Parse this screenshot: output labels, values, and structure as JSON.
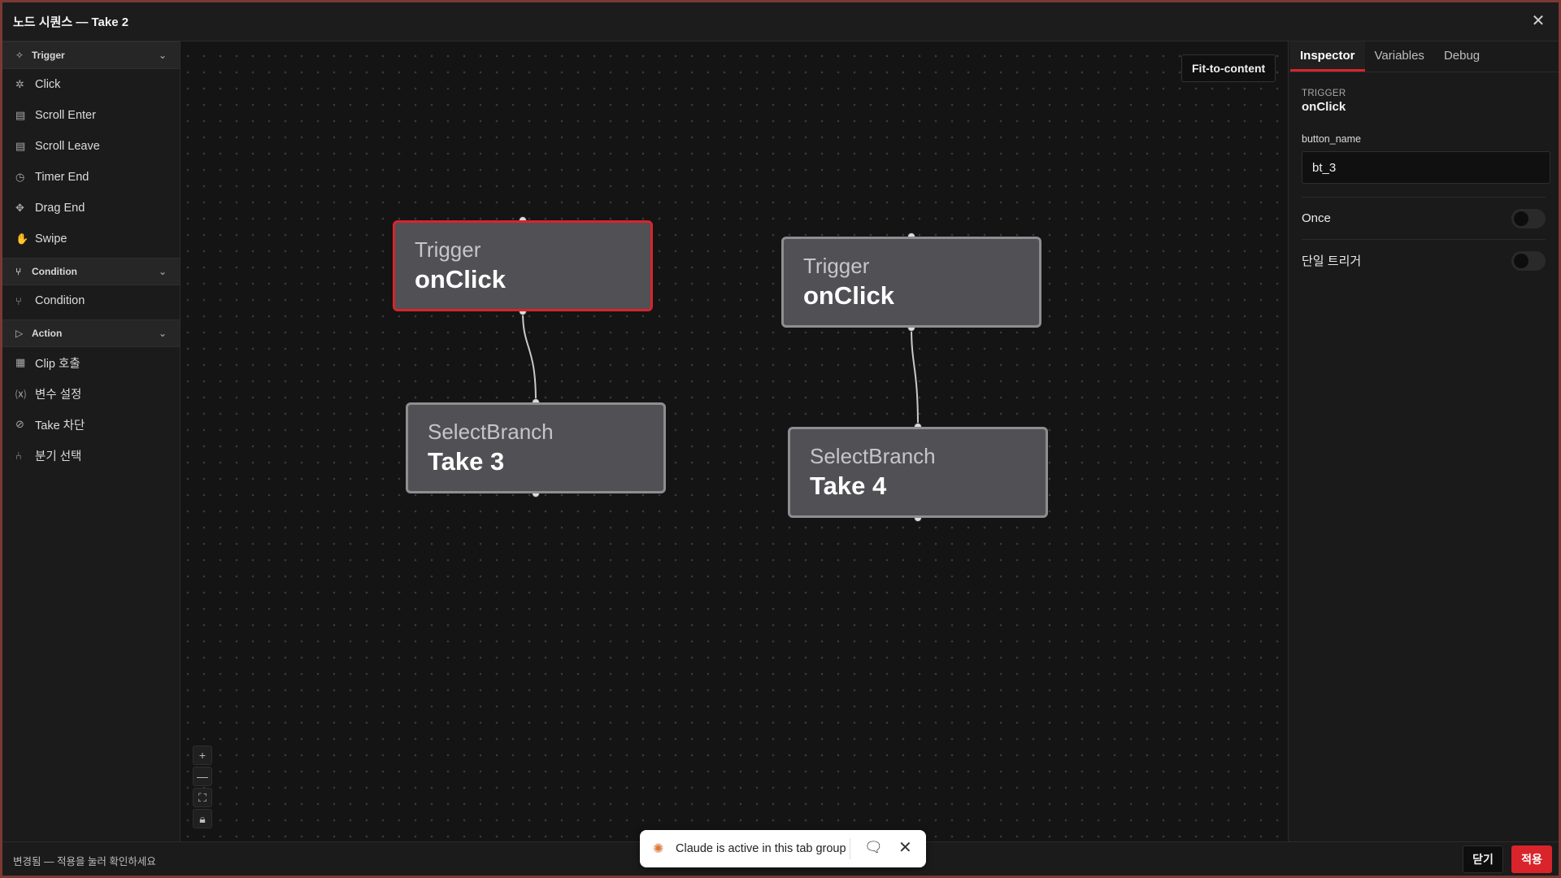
{
  "window": {
    "title": "노드 시퀀스 — Take 2",
    "close_icon": "close-icon"
  },
  "sidebar": {
    "groups": [
      {
        "label": "Trigger",
        "icon": "trigger-icon",
        "items": [
          {
            "label": "Click",
            "icon": "click-icon"
          },
          {
            "label": "Scroll Enter",
            "icon": "scroll-enter-icon"
          },
          {
            "label": "Scroll Leave",
            "icon": "scroll-leave-icon"
          },
          {
            "label": "Timer End",
            "icon": "timer-icon"
          },
          {
            "label": "Drag End",
            "icon": "drag-icon"
          },
          {
            "label": "Swipe",
            "icon": "hand-icon"
          }
        ]
      },
      {
        "label": "Condition",
        "icon": "branch-icon",
        "items": [
          {
            "label": "Condition",
            "icon": "branch-icon"
          }
        ]
      },
      {
        "label": "Action",
        "icon": "play-icon",
        "items": [
          {
            "label": "Clip 호출",
            "icon": "film-icon"
          },
          {
            "label": "변수 설정",
            "icon": "variable-icon"
          },
          {
            "label": "Take 차단",
            "icon": "block-icon"
          },
          {
            "label": "분기 선택",
            "icon": "fork-icon"
          }
        ]
      }
    ]
  },
  "canvas": {
    "fit_button": "Fit-to-content",
    "nodes": [
      {
        "type": "Trigger",
        "name": "onClick",
        "selected": true
      },
      {
        "type": "SelectBranch",
        "name": "Take 3",
        "selected": false
      },
      {
        "type": "Trigger",
        "name": "onClick",
        "selected": false
      },
      {
        "type": "SelectBranch",
        "name": "Take 4",
        "selected": false
      }
    ],
    "zoom_controls": [
      "zoom-in-icon",
      "zoom-out-icon",
      "fullscreen-icon",
      "lock-icon"
    ]
  },
  "inspector": {
    "tabs": [
      {
        "label": "Inspector",
        "active": true
      },
      {
        "label": "Variables",
        "active": false
      },
      {
        "label": "Debug",
        "active": false
      }
    ],
    "section_label": "TRIGGER",
    "section_value": "onClick",
    "field_label": "button_name",
    "field_value": "bt_3",
    "toggles": [
      {
        "label": "Once",
        "on": false
      },
      {
        "label": "단일 트리거",
        "on": false
      }
    ]
  },
  "footer": {
    "status": "변경됨 — 적용을 눌러 확인하세요",
    "close_label": "닫기",
    "apply_label": "적용"
  },
  "claude_bar": {
    "message": "Claude is active in this tab group"
  },
  "colors": {
    "accent": "#d9242c",
    "node_fill": "#505055",
    "canvas": "#141414"
  }
}
